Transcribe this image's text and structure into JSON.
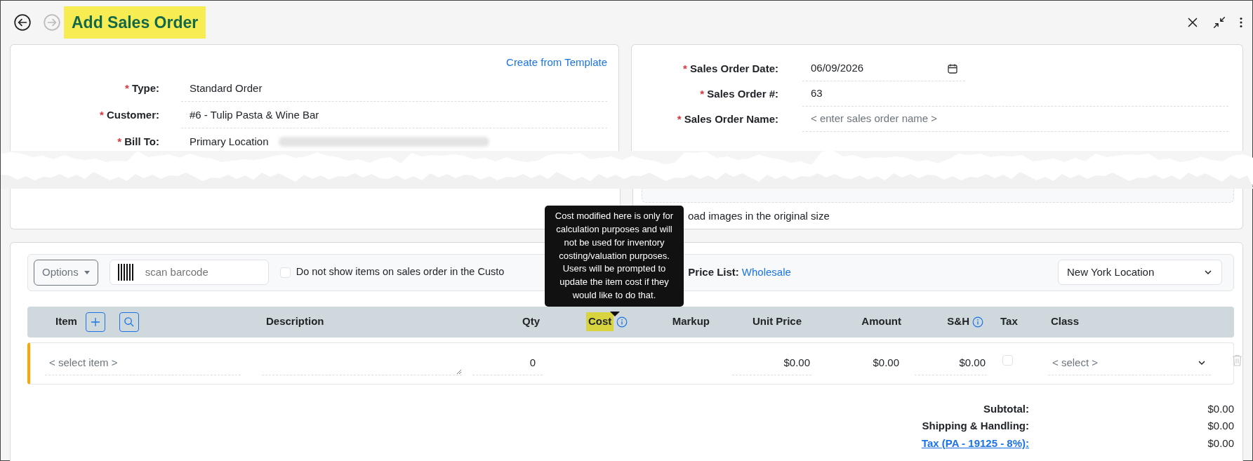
{
  "header": {
    "title": "Add Sales Order",
    "title_highlighted": true,
    "back_disabled": false,
    "forward_disabled": true
  },
  "order_info": {
    "template_link": "Create from Template",
    "fields": [
      {
        "required_mark": "*",
        "label": "Type:",
        "value": "Standard Order",
        "redacted": false
      },
      {
        "required_mark": "*",
        "label": "Customer:",
        "value": "#6 - Tulip Pasta & Wine Bar",
        "redacted": false
      },
      {
        "required_mark": "*",
        "label": "Bill To:",
        "value": "Primary Location",
        "redacted": true
      }
    ]
  },
  "order_details": {
    "fields": [
      {
        "required_mark": "*",
        "label": "Sales Order Date:",
        "kind": "date",
        "value": "06/09/2026"
      },
      {
        "required_mark": "*",
        "label": "Sales Order #:",
        "kind": "text",
        "value": "63"
      },
      {
        "required_mark": "*",
        "label": "Sales Order Name:",
        "kind": "text",
        "placeholder": "< enter sales order name >"
      }
    ],
    "upload_option": {
      "label": "oad images in the original size"
    }
  },
  "toolbar": {
    "options_button": "Options",
    "barcode_placeholder": "scan barcode",
    "hide_items": {
      "label": "Do not show items on sales order in the Custo",
      "checked": false
    },
    "price_list": {
      "label": "Price List:",
      "value": "Wholesale"
    },
    "location": "New York Location"
  },
  "tooltip": "Cost modified here is only for calculation purposes and will not be used for inventory costing/valuation purposes. Users will be prompted to update the item cost if they would like to do that.",
  "columns": [
    {
      "label": "Item",
      "info": false,
      "highlighted": false
    },
    {
      "label": "Description",
      "info": false,
      "highlighted": false
    },
    {
      "label": "Qty",
      "info": false,
      "highlighted": false
    },
    {
      "label": "Cost",
      "info": true,
      "highlighted": true
    },
    {
      "label": "Markup",
      "info": false,
      "highlighted": false
    },
    {
      "label": "Unit Price",
      "info": false,
      "highlighted": false
    },
    {
      "label": "Amount",
      "info": false,
      "highlighted": false
    },
    {
      "label": "S&H",
      "info": true,
      "highlighted": false
    },
    {
      "label": "Tax",
      "info": false,
      "highlighted": false
    },
    {
      "label": "Class",
      "info": false,
      "highlighted": false
    }
  ],
  "rows": [
    {
      "item_placeholder": "< select item >",
      "qty": "0",
      "unit_price": "$0.00",
      "amount": "$0.00",
      "shipping": "$0.00",
      "taxable": false,
      "class_placeholder": "< select >"
    }
  ],
  "totals": [
    {
      "label": "Subtotal:",
      "value": "$0.00",
      "link": false
    },
    {
      "label": "Shipping & Handling:",
      "value": "$0.00",
      "link": false
    },
    {
      "label": "Tax (PA - 19125 - 8%):",
      "value": "$0.00",
      "link": true
    }
  ]
}
